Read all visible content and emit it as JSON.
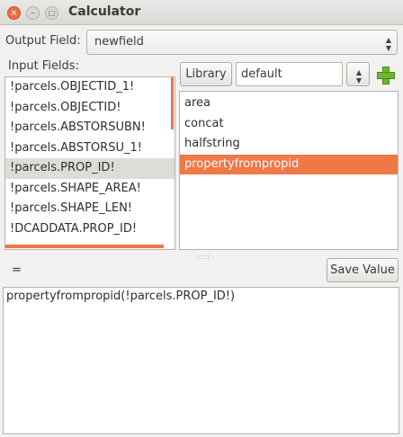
{
  "window": {
    "title": "Calculator",
    "close_glyph": "×",
    "min_glyph": "–",
    "max_glyph": "□"
  },
  "output_field": {
    "label": "Output Field:",
    "value": "newfield"
  },
  "input_fields": {
    "label": "Input Fields:",
    "items": [
      "!parcels.OBJECTID_1!",
      "!parcels.OBJECTID!",
      "!parcels.ABSTORSUBN!",
      "!parcels.ABSTORSU_1!",
      "!parcels.PROP_ID!",
      "!parcels.SHAPE_AREA!",
      "!parcels.SHAPE_LEN!",
      "!DCADDATA.PROP_ID!"
    ],
    "selected_index": 4
  },
  "library": {
    "button_label": "Library",
    "name_value": "default",
    "functions": [
      "area",
      "concat",
      "halfstring",
      "propertyfrompropid"
    ],
    "selected_index": 3
  },
  "equals_label": "=",
  "save_button_label": "Save Value",
  "expression": "propertyfrompropid(!parcels.PROP_ID!)",
  "colors": {
    "accent": "#f07746",
    "add_icon": "#6fb52f"
  }
}
